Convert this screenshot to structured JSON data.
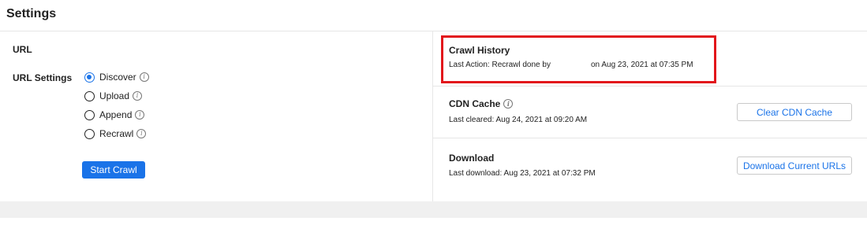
{
  "header": {
    "title": "Settings"
  },
  "left": {
    "url_label": "URL",
    "url_settings_label": "URL Settings",
    "options": [
      {
        "label": "Discover",
        "checked": true
      },
      {
        "label": "Upload",
        "checked": false
      },
      {
        "label": "Append",
        "checked": false
      },
      {
        "label": "Recrawl",
        "checked": false
      }
    ],
    "start_button": "Start Crawl"
  },
  "crawl_history": {
    "title": "Crawl History",
    "last_action": "Last Action: Recrawl done by",
    "last_action_time": "on Aug 23, 2021 at 07:35 PM"
  },
  "cdn_cache": {
    "title": "CDN Cache",
    "last_cleared": "Last cleared: Aug 24, 2021 at 09:20 AM",
    "button": "Clear CDN Cache"
  },
  "download": {
    "title": "Download",
    "last_download": "Last download: Aug 23, 2021 at 07:32 PM",
    "button": "Download Current URLs"
  },
  "colors": {
    "accent": "#1a73e8",
    "highlight": "#e2151b",
    "divider": "#e6e6e6"
  },
  "icons": {
    "info": "info-icon"
  }
}
